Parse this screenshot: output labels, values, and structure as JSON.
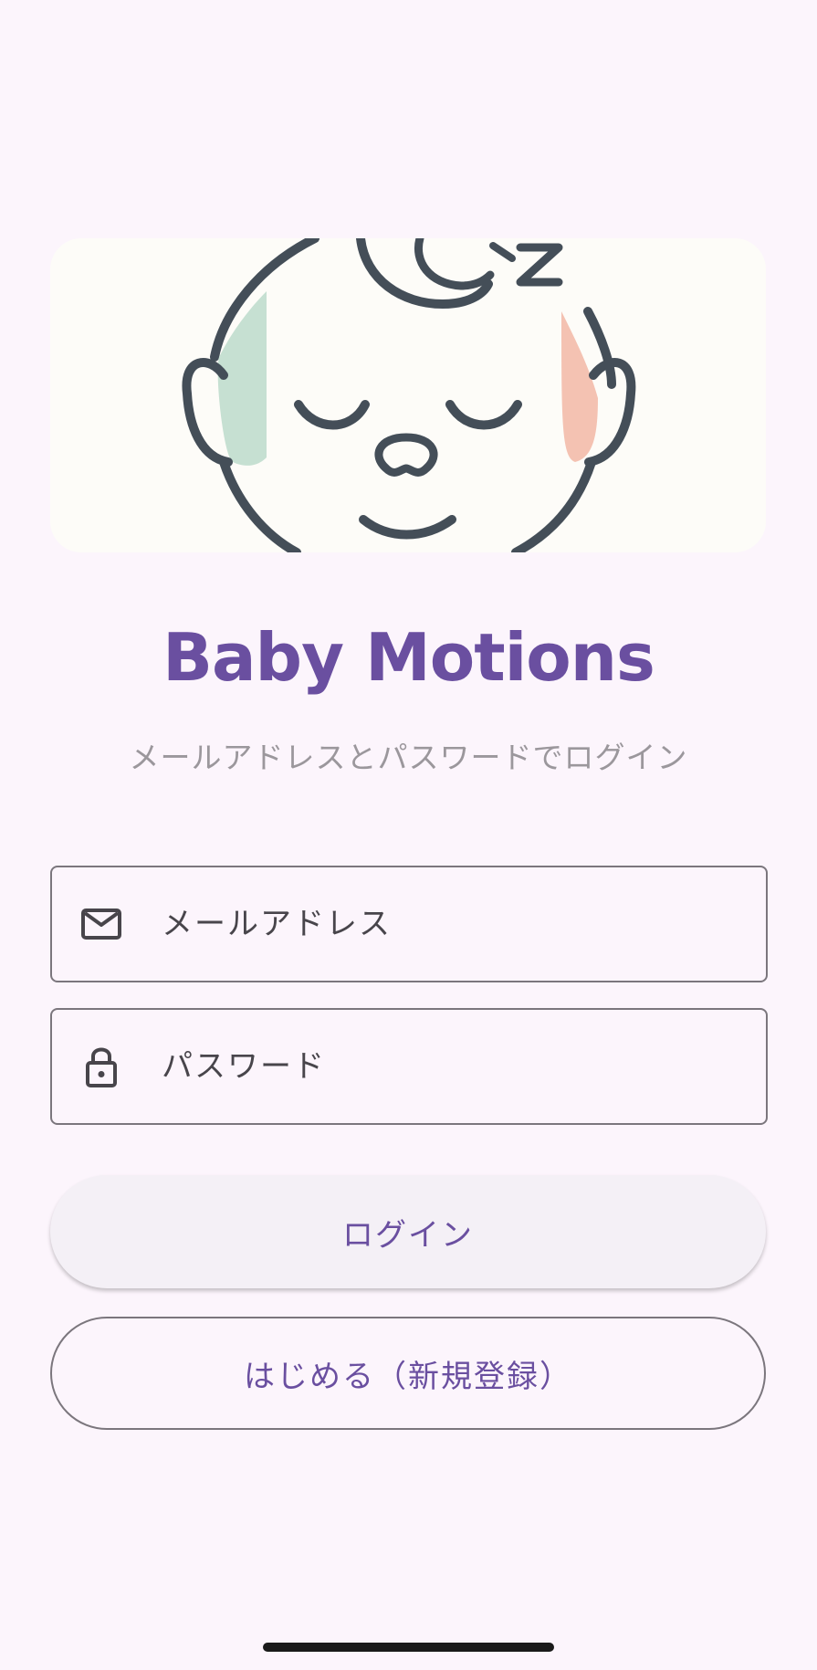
{
  "hero": {
    "image_name": "sleeping-baby-illustration",
    "colors": {
      "background": "#fdfcf8",
      "outline": "#444e58",
      "left_cheek": "#c6e0d2",
      "right_cheek": "#f4c2b2"
    }
  },
  "app": {
    "title": "Baby Motions",
    "subtitle": "メールアドレスとパスワードでログイン"
  },
  "form": {
    "email": {
      "icon": "mail-icon",
      "placeholder": "メールアドレス",
      "value": ""
    },
    "password": {
      "icon": "lock-icon",
      "placeholder": "パスワード",
      "value": ""
    }
  },
  "buttons": {
    "login_label": "ログイン",
    "signup_label": "はじめる（新規登録）"
  },
  "colors": {
    "background": "#fcf5fc",
    "accent": "#6a4fa0",
    "subtitle": "#9b979c",
    "field_border": "#7b767d"
  }
}
